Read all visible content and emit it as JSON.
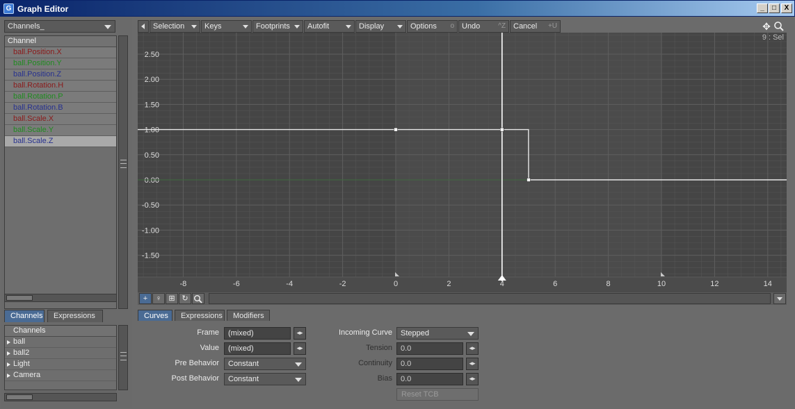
{
  "window": {
    "title": "Graph Editor",
    "controls": [
      "_",
      "□",
      "X"
    ]
  },
  "left": {
    "top_dropdown": "Channels_",
    "channel_header": "Channel",
    "channels": [
      {
        "label": "ball.Position.X",
        "color": "#8b1a1a"
      },
      {
        "label": "ball.Position.Y",
        "color": "#1f8b1f"
      },
      {
        "label": "ball.Position.Z",
        "color": "#27318f"
      },
      {
        "label": "ball.Rotation.H",
        "color": "#8b1a1a"
      },
      {
        "label": "ball.Rotation.P",
        "color": "#1f8b1f"
      },
      {
        "label": "ball.Rotation.B",
        "color": "#27318f"
      },
      {
        "label": "ball.Scale.X",
        "color": "#8b1a1a"
      },
      {
        "label": "ball.Scale.Y",
        "color": "#1f8b1f"
      },
      {
        "label": "ball.Scale.Z",
        "color": "#27318f"
      }
    ],
    "tabs": [
      "Channels",
      "Expressions"
    ],
    "scene_header": "Channels",
    "scene_items": [
      "ball",
      "ball2",
      "Light",
      "Camera"
    ]
  },
  "toolbar": {
    "items": [
      "Selection",
      "Keys",
      "Footprints",
      "Autofit",
      "Display",
      "Options",
      "Undo",
      "Cancel"
    ],
    "undo_shortcut": "^Z",
    "cancel_shortcut": "+U",
    "options_mark": "o",
    "sel_count": "9 : Sel"
  },
  "graph": {
    "y_ticks": [
      "2.50",
      "2.00",
      "1.50",
      "1.00",
      "0.50",
      "0.00",
      "-0.50",
      "-1.00",
      "-1.50"
    ],
    "x_ticks": [
      "-8",
      "-6",
      "-4",
      "-2",
      "0",
      "2",
      "4",
      "6",
      "8",
      "10",
      "12",
      "14"
    ],
    "current_frame": 4,
    "curve": {
      "type": "stepped",
      "keys": [
        {
          "frame": 0,
          "value": 1.0
        },
        {
          "frame": 4,
          "value": 1.0
        },
        {
          "frame": 5,
          "value": 0.0
        }
      ]
    }
  },
  "bottom_tabs": [
    "Curves",
    "Expressions",
    "Modifiers"
  ],
  "curves_panel": {
    "frame_label": "Frame",
    "frame_value": "(mixed)",
    "value_label": "Value",
    "value_value": "(mixed)",
    "pre_behavior_label": "Pre Behavior",
    "pre_behavior_value": "Constant",
    "post_behavior_label": "Post Behavior",
    "post_behavior_value": "Constant",
    "incoming_curve_label": "Incoming Curve",
    "incoming_curve_value": "Stepped",
    "tension_label": "Tension",
    "tension_value": "0.0",
    "continuity_label": "Continuity",
    "continuity_value": "0.0",
    "bias_label": "Bias",
    "bias_value": "0.0",
    "reset_tcb": "Reset TCB"
  }
}
